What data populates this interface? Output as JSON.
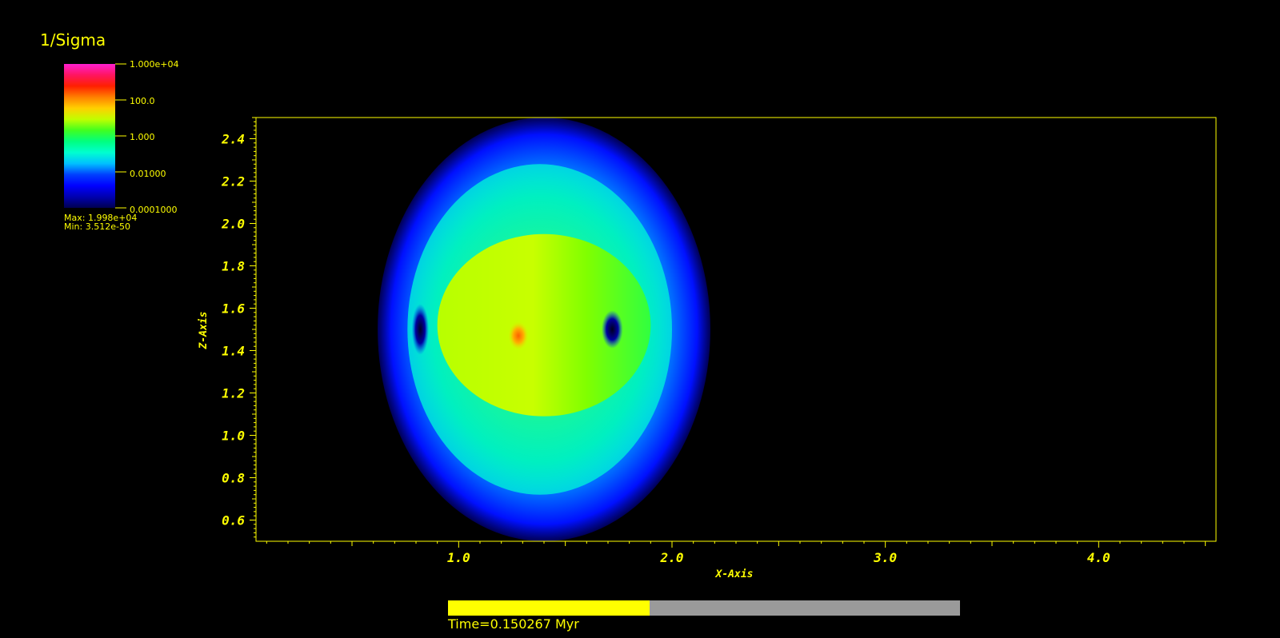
{
  "legend": {
    "title": "1/Sigma",
    "tick_labels": [
      "1.000e+04",
      "100.0",
      "1.000",
      "0.01000",
      "0.0001000"
    ],
    "max_label": "Max:  1.998e+04",
    "min_label": "Min:  3.512e-50",
    "colormap": [
      "#ff1fd0",
      "#ff1560",
      "#ff2000",
      "#ff8000",
      "#ffd000",
      "#c0ff00",
      "#40ff20",
      "#00ff80",
      "#00ffd0",
      "#00c0ff",
      "#0040ff",
      "#0000ff",
      "#0000b0",
      "#000050"
    ]
  },
  "colors": {
    "foreground": "#ffff00",
    "background": "#000000",
    "progress_track": "#9a9a9a"
  },
  "chart_data": {
    "type": "heatmap",
    "title": "",
    "xlabel": "X-Axis",
    "ylabel": "Z-Axis",
    "xlim": [
      0.05,
      4.55
    ],
    "ylim": [
      0.5,
      2.5
    ],
    "x_ticks": [
      1.0,
      2.0,
      3.0,
      4.0
    ],
    "x_tick_labels": [
      "1.0",
      "2.0",
      "3.0",
      "4.0"
    ],
    "y_ticks": [
      0.6,
      0.8,
      1.0,
      1.2,
      1.4,
      1.6,
      1.8,
      2.0,
      2.2,
      2.4
    ],
    "y_tick_labels": [
      "0.6",
      "0.8",
      "1.0",
      "1.2",
      "1.4",
      "1.6",
      "1.8",
      "2.0",
      "2.2",
      "2.4"
    ],
    "colorbar": {
      "scale": "log",
      "range": [
        0.0001,
        10000
      ],
      "max": 19980,
      "min": 3.512e-50
    },
    "features": [
      {
        "kind": "outer-shell",
        "cx": 1.4,
        "cz": 1.5,
        "rx": 0.78,
        "rz": 1.0,
        "value": 0.003
      },
      {
        "kind": "bright-ring",
        "cx": 1.38,
        "cz": 1.5,
        "rx": 0.62,
        "rz": 0.78,
        "value": 0.05
      },
      {
        "kind": "inner-bubble",
        "cx": 1.4,
        "cz": 1.52,
        "rx": 0.5,
        "rz": 0.43,
        "value": 2.0
      },
      {
        "kind": "core",
        "cx": 1.28,
        "cz": 1.47,
        "rx": 0.05,
        "rz": 0.07,
        "value": 40
      },
      {
        "kind": "dark-spot",
        "cx": 0.82,
        "cz": 1.5,
        "rx": 0.04,
        "rz": 0.12,
        "value": 0.0005
      },
      {
        "kind": "dark-spot",
        "cx": 1.72,
        "cz": 1.5,
        "rx": 0.05,
        "rz": 0.09,
        "value": 0.0005
      }
    ]
  },
  "time": {
    "label": "Time=0.150267 Myr",
    "progress_fraction": 0.394
  }
}
